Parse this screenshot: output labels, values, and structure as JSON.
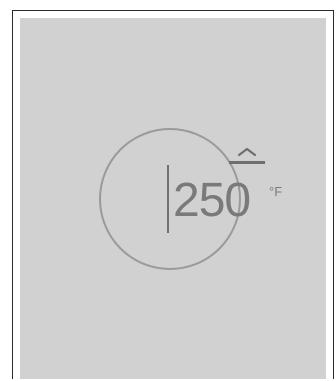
{
  "thermostat": {
    "temperature": "250",
    "unit": "°F",
    "increase_icon": "chevron-up-icon"
  },
  "colors": {
    "panel": "#d1d1d1",
    "ring": "#9a9a9a",
    "text": "#7a7a7a"
  }
}
